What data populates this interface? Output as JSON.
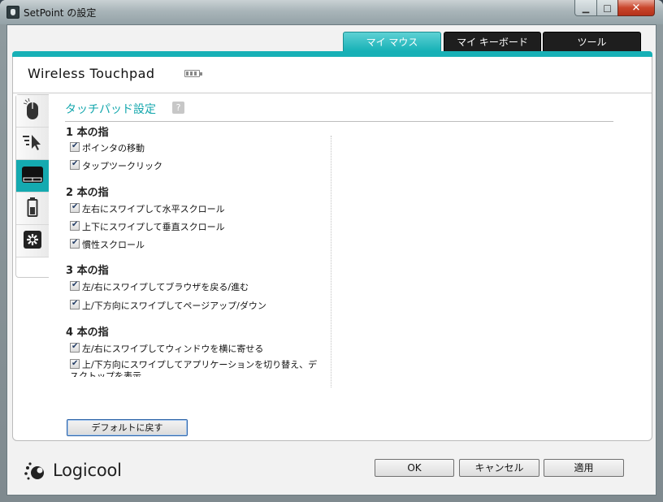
{
  "window": {
    "title": "SetPoint の設定"
  },
  "tabs": [
    {
      "label": "マイ マウス",
      "active": true
    },
    {
      "label": "マイ キーボード",
      "active": false
    },
    {
      "label": "ツール",
      "active": false
    }
  ],
  "device": {
    "name": "Wireless Touchpad"
  },
  "sidebar": {
    "items": [
      {
        "icon": "mouse-icon"
      },
      {
        "icon": "pointer-icon"
      },
      {
        "icon": "touchpad-icon",
        "active": true
      },
      {
        "icon": "battery-icon"
      },
      {
        "icon": "tools-icon"
      }
    ]
  },
  "section": {
    "title": "タッチパッド設定",
    "help": "?"
  },
  "groups": [
    {
      "heading": "1 本の指",
      "items": [
        "ポインタの移動",
        "タップツークリック"
      ]
    },
    {
      "heading": "2 本の指",
      "items": [
        "左右にスワイプして水平スクロール",
        "上下にスワイプして垂直スクロール",
        "慣性スクロール"
      ]
    },
    {
      "heading": "3 本の指",
      "items": [
        "左/右にスワイプしてブラウザを戻る/進む",
        "上/下方向にスワイプしてページアップ/ダウン"
      ]
    },
    {
      "heading": "4 本の指",
      "items": [
        "左/右にスワイプしてウィンドウを横に寄せる",
        "上/下方向にスワイプしてアプリケーションを切り替え、デスクトップを表示"
      ]
    }
  ],
  "buttons": {
    "default": "デフォルトに戻す",
    "ok": "OK",
    "cancel": "キャンセル",
    "apply": "適用"
  },
  "brand": {
    "name": "Logicool"
  },
  "colors": {
    "accent": "#17b0b6",
    "tab_inactive": "#1e1e1e"
  }
}
